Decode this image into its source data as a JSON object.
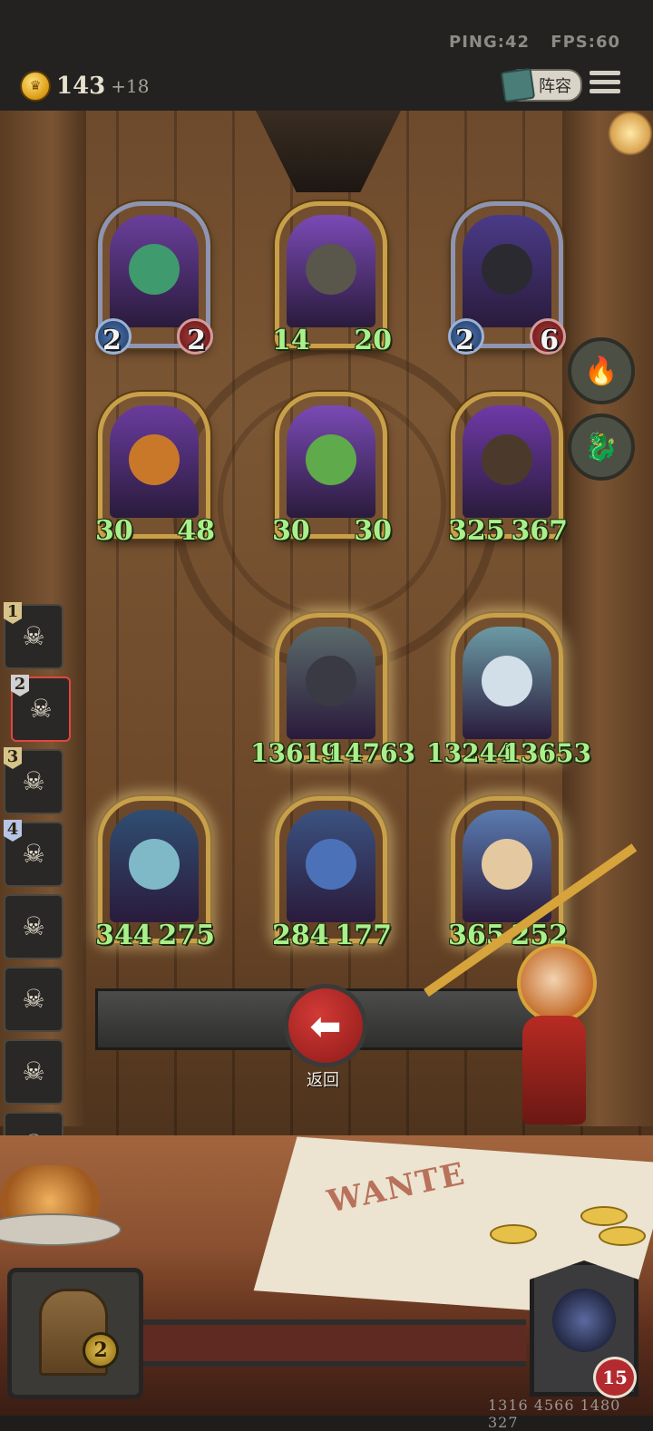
{
  "hud": {
    "ping_label": "PING:42",
    "fps_label": "FPS:60",
    "gold": "143",
    "gold_income": "+18",
    "lineup_label": "阵容"
  },
  "board": {
    "rows": [
      [
        {
          "attack": "2",
          "health": "2",
          "style": "badge",
          "bg": "#6a3f9c",
          "face": "#3f9a6e"
        },
        {
          "attack": "14",
          "health": "20",
          "style": "plain",
          "bg": "#7a4ab5",
          "face": "#59564c"
        },
        {
          "attack": "2",
          "health": "6",
          "style": "badge",
          "bg": "#4a3b88",
          "face": "#2a2a30"
        }
      ],
      [
        {
          "attack": "30",
          "health": "48",
          "style": "plain",
          "bg": "#6a3c9e",
          "face": "#c9782a"
        },
        {
          "attack": "30",
          "health": "30",
          "style": "plain",
          "bg": "#7a4ab5",
          "face": "#5faa4a"
        },
        {
          "attack": "325",
          "health": "367",
          "style": "plain",
          "bg": "#6f3aa8",
          "face": "#4b3a2c"
        }
      ],
      [
        {
          "attack": "13619",
          "health": "14763",
          "style": "plain",
          "bg": "#5a6a6a",
          "face": "#3a3a44"
        },
        {
          "attack": "13244",
          "health": "13653",
          "style": "plain",
          "bg": "#6b9aa4",
          "face": "#d2dfe8"
        }
      ],
      [
        {
          "attack": "344",
          "health": "275",
          "style": "plain",
          "bg": "#2f4e72",
          "face": "#7fb9c8"
        },
        {
          "attack": "284",
          "health": "177",
          "style": "plain",
          "bg": "#3b5280",
          "face": "#4b72b8"
        },
        {
          "attack": "365",
          "health": "252",
          "style": "plain",
          "bg": "#5a7bb0",
          "face": "#e4c9a0"
        }
      ]
    ]
  },
  "roster": [
    {
      "num": "1",
      "active": false
    },
    {
      "num": "2",
      "active": true
    },
    {
      "num": "3",
      "active": false
    },
    {
      "num": "4",
      "active": false
    },
    {
      "num": "",
      "active": false
    },
    {
      "num": "",
      "active": false
    },
    {
      "num": "",
      "active": false
    },
    {
      "num": "",
      "active": false
    }
  ],
  "back_label": "返回",
  "poster_text": "WANTE",
  "chest_count": "2",
  "player_level": "15",
  "uid": "1316 4566 1480 327"
}
